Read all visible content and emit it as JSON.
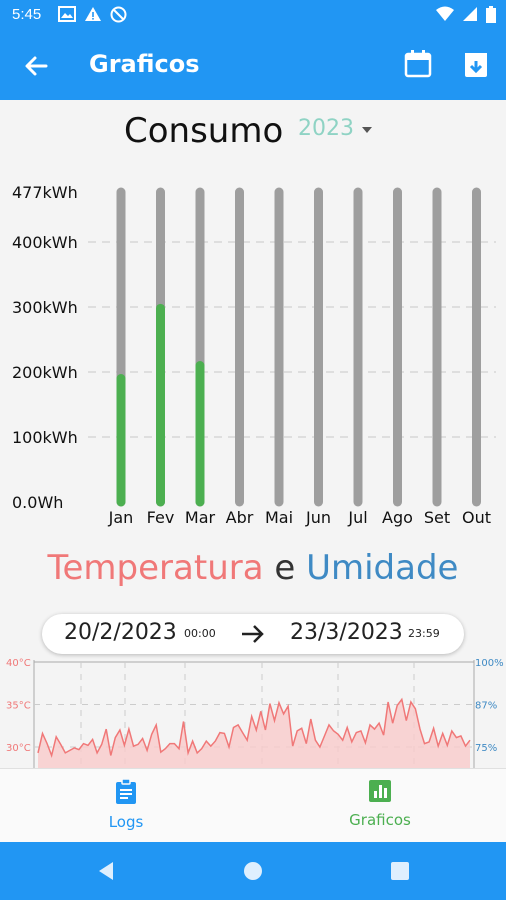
{
  "status": {
    "time": "5:45"
  },
  "appbar": {
    "title": "Graficos"
  },
  "header": {
    "title": "Consumo",
    "year": "2023"
  },
  "chart_data": {
    "type": "bar",
    "title": "Consumo",
    "categories": [
      "Jan",
      "Fev",
      "Mar",
      "Abr",
      "Mai",
      "Jun",
      "Jul",
      "Ago",
      "Set",
      "Out"
    ],
    "values": [
      190,
      298,
      210,
      0,
      0,
      0,
      0,
      0,
      0,
      0
    ],
    "ylim": [
      0,
      477
    ],
    "yticks": [
      {
        "value": 0,
        "label": "0.0Wh"
      },
      {
        "value": 100,
        "label": "100kWh"
      },
      {
        "value": 200,
        "label": "200kWh"
      },
      {
        "value": 300,
        "label": "300kWh"
      },
      {
        "value": 400,
        "label": "400kWh"
      },
      {
        "value": 477,
        "label": "477kWh"
      }
    ],
    "bar_color": "#4caf50",
    "track_color": "#9e9e9e",
    "grid": true
  },
  "temp_humidity": {
    "title_temp": "Temperatura",
    "title_and": "e",
    "title_hum": "Umidade",
    "colors": {
      "temp": "#f07878",
      "hum": "#3f8ac4"
    },
    "range": {
      "start_date": "20/2/2023",
      "start_time": "00:00",
      "end_date": "23/3/2023",
      "end_time": "23:59"
    },
    "left_axis": [
      "40°C",
      "35°C",
      "30°C"
    ],
    "right_axis": [
      "100%",
      "87%",
      "75%"
    ],
    "temp_series": [
      29.3,
      31.6,
      30.4,
      29.0,
      31.2,
      30.3,
      29.3,
      29.6,
      29.9,
      29.7,
      30.4,
      30.2,
      30.9,
      29.3,
      30.3,
      32.1,
      29.0,
      31.1,
      32.0,
      30.2,
      32.1,
      30.1,
      30.3,
      31.0,
      29.6,
      31.5,
      32.6,
      29.4,
      29.8,
      30.4,
      30.4,
      29.8,
      33.0,
      29.3,
      30.7,
      29.3,
      29.8,
      30.7,
      30.1,
      30.7,
      31.7,
      31.6,
      30.0,
      32.3,
      32.6,
      31.7,
      30.8,
      33.6,
      32.0,
      34.2,
      32.0,
      35.1,
      33.1,
      35.2,
      33.9,
      34.8,
      30.1,
      31.9,
      32.2,
      30.4,
      33.3,
      30.8,
      30.0,
      31.3,
      32.6,
      31.9,
      31.5,
      30.8,
      32.3,
      30.6,
      31.7,
      31.9,
      30.5,
      32.6,
      32.1,
      32.8,
      31.4,
      35.3,
      32.8,
      34.9,
      35.6,
      33.1,
      35.3,
      34.5,
      32.1,
      30.4,
      30.6,
      32.2,
      30.1,
      31.6,
      30.2,
      31.9,
      31.1,
      31.3,
      30.1,
      30.8
    ]
  },
  "nav": {
    "logs": "Logs",
    "graficos": "Graficos"
  }
}
